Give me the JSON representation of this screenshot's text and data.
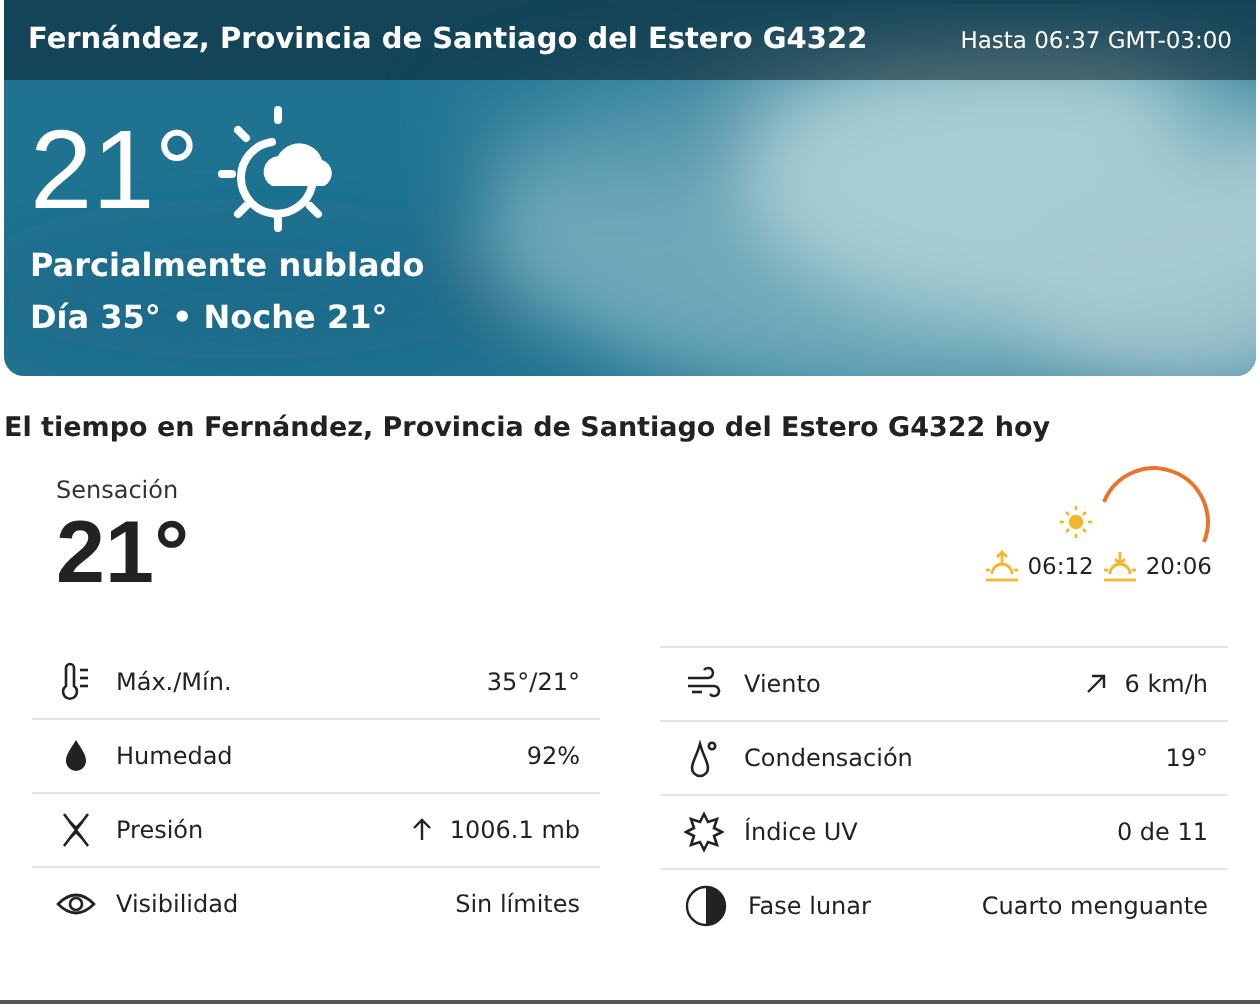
{
  "location": "Fernández, Provincia de Santiago del Estero G4322",
  "valid_until": "Hasta 06:37 GMT-03:00",
  "current": {
    "temperature": "21°",
    "condition": "Parcialmente nublado",
    "day_night": "Día 35° • Noche 21°"
  },
  "heading": "El tiempo en Fernández, Provincia de Santiago del Estero G4322 hoy",
  "feels_like": {
    "label": "Sensación",
    "value": "21°"
  },
  "sun": {
    "sunrise": "06:12",
    "sunset": "20:06"
  },
  "details": [
    [
      {
        "kind": "temperature",
        "label": "Máx./Mín.",
        "value": "35°/21°"
      },
      {
        "kind": "humidity",
        "label": "Humedad",
        "value": "92%"
      },
      {
        "kind": "pressure",
        "label": "Presión",
        "value": "1006.1 mb"
      },
      {
        "kind": "visibility",
        "label": "Visibilidad",
        "value": "Sin límites"
      }
    ],
    [
      {
        "kind": "wind",
        "label": "Viento",
        "value": "6 km/h"
      },
      {
        "kind": "dewpoint",
        "label": "Condensación",
        "value": "19°"
      },
      {
        "kind": "uv",
        "label": "Índice UV",
        "value": "0 de 11"
      },
      {
        "kind": "moon",
        "label": "Fase lunar",
        "value": "Cuarto menguante"
      }
    ]
  ]
}
